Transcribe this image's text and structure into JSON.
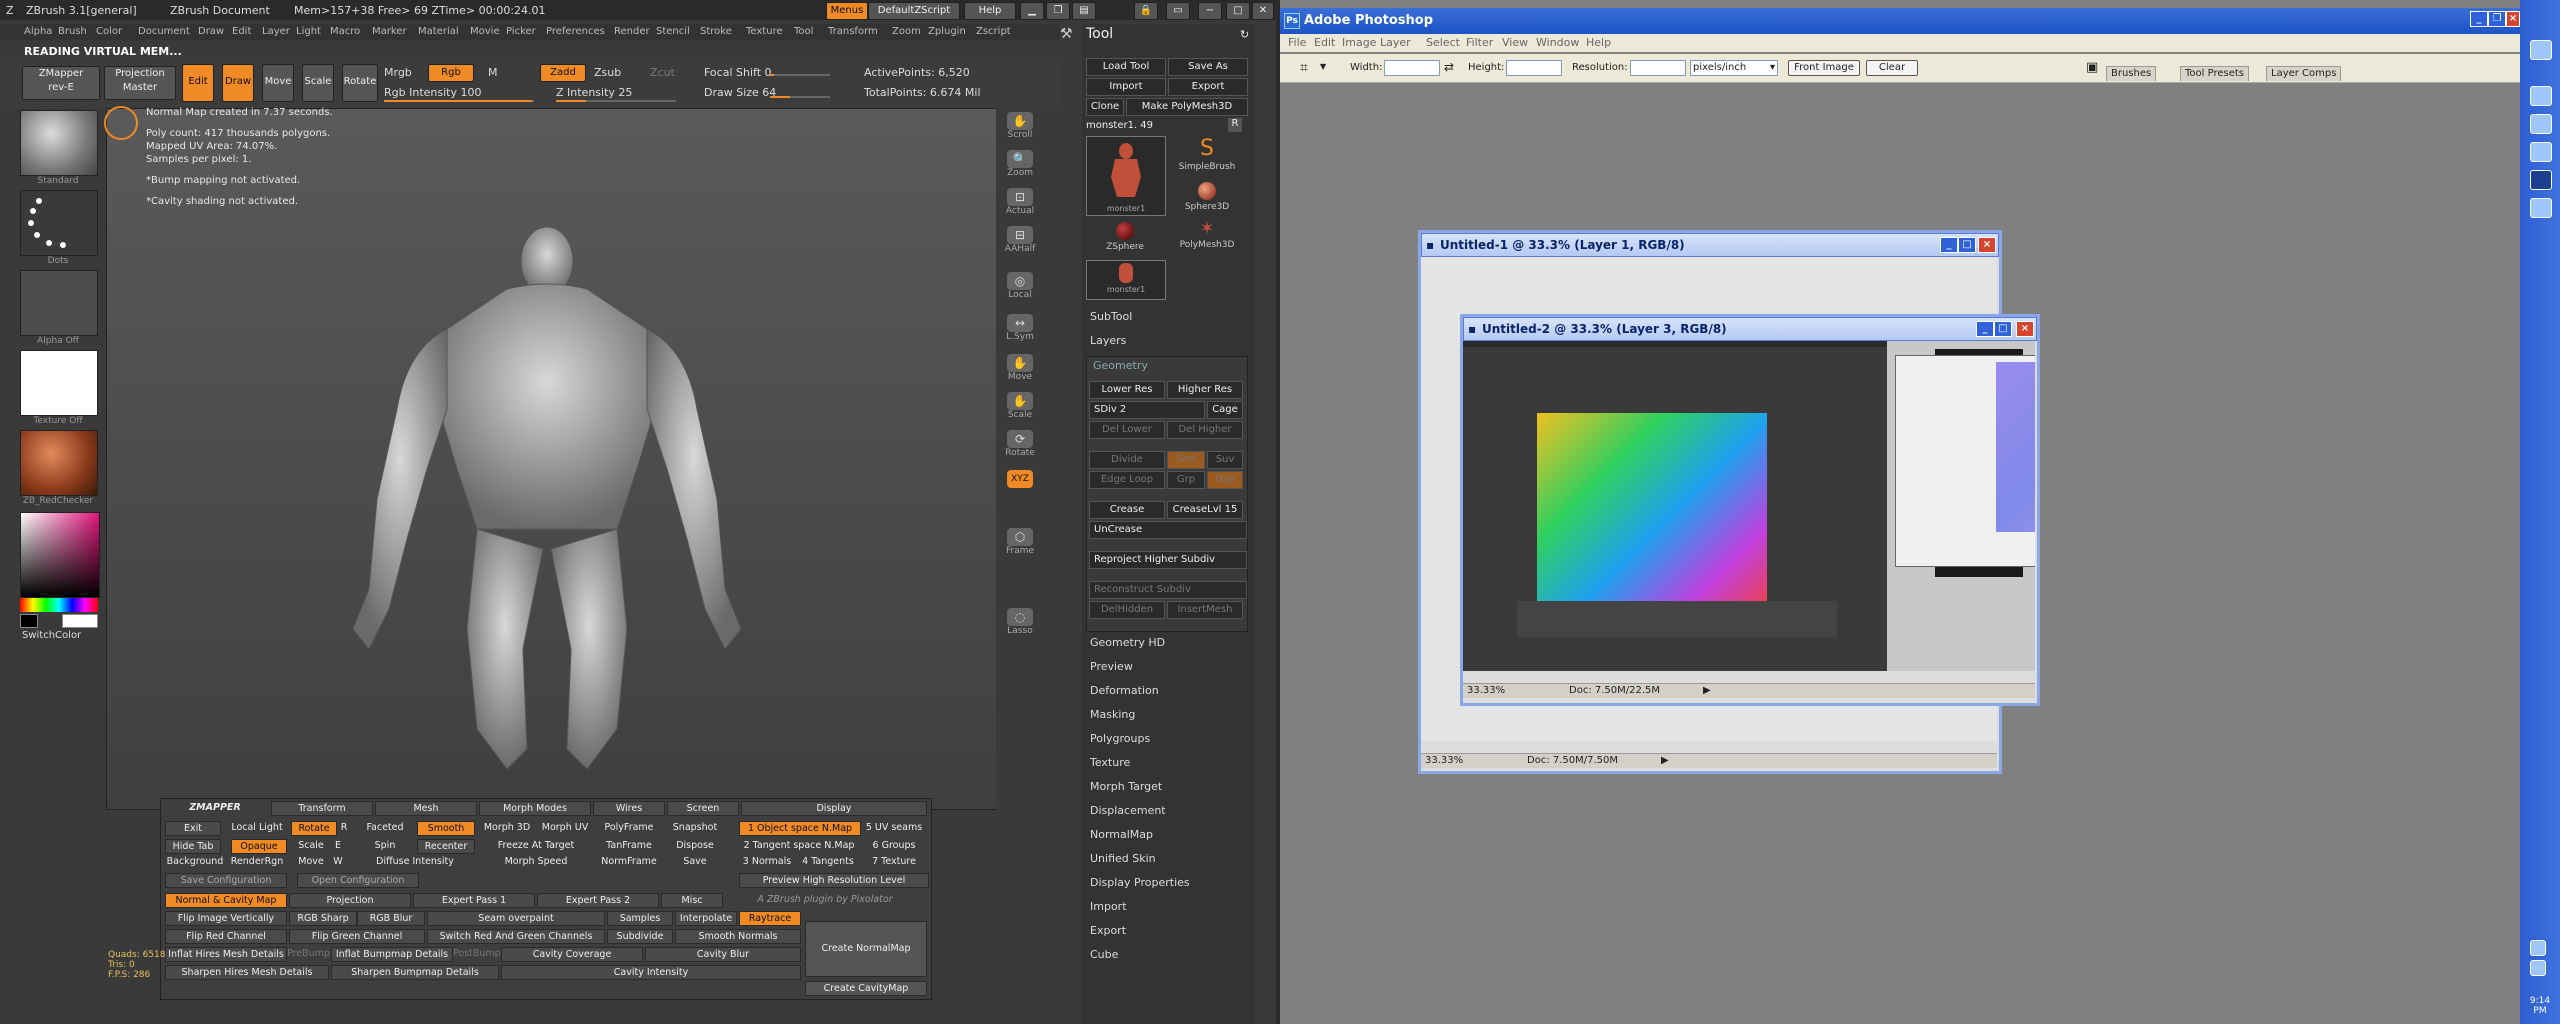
{
  "zbrush": {
    "title": "ZBrush 3.1[general]",
    "document": "ZBrush Document",
    "mem": "Mem>157+38  Free> 69  ZTime> 00:00:24.01",
    "menus_btn": "Menus",
    "script_btn": "DefaultZScript",
    "help_btn": "Help",
    "menubar": [
      "Alpha",
      "Brush",
      "Color",
      "Document",
      "Draw",
      "Edit",
      "Layer",
      "Light",
      "Macro",
      "Marker",
      "Material",
      "Movie",
      "Picker",
      "Preferences",
      "Render",
      "Stencil",
      "Stroke",
      "Texture",
      "Tool",
      "Transform",
      "Zoom",
      "Zplugin",
      "Zscript"
    ],
    "status_line": "READING VIRTUAL MEM...",
    "shelf": {
      "zmapper": "ZMapper",
      "zmapper_sub": "rev-E",
      "projection": "Projection",
      "projection_sub": "Master",
      "edit": "Edit",
      "draw": "Draw",
      "move": "Move",
      "scale": "Scale",
      "rotate": "Rotate",
      "mrgb": "Mrgb",
      "rgb": "Rgb",
      "m": "M",
      "zadd": "Zadd",
      "zsub": "Zsub",
      "zcut": "Zcut",
      "rgb_intensity": "Rgb Intensity 100",
      "z_intensity": "Z Intensity 25",
      "focal_shift": "Focal Shift 0",
      "draw_size": "Draw Size 64",
      "active_points": "ActivePoints: 6,520",
      "total_points": "TotalPoints: 6.674 Mil"
    },
    "left_labels": [
      "Standard",
      "Dots",
      "Alpha  Off",
      "Texture Off",
      "ZB_RedChecker",
      "SwitchColor"
    ],
    "info_lines": [
      "Normal Map created in 7.37 seconds.",
      "",
      "Poly count: 417 thousands polygons.",
      "Mapped UV Area: 74.07%.",
      "Samples per pixel: 1.",
      "",
      "*Bump mapping not activated.",
      "",
      "*Cavity shading not activated."
    ],
    "right_strip": [
      "Scroll",
      "Zoom",
      "Actual",
      "AAHalf",
      "Local",
      "L.Sym",
      "Move",
      "Scale",
      "Rotate",
      "XYZ",
      "Frame",
      "Lasso"
    ],
    "tool": {
      "header": "Tool",
      "load_tool": "Load Tool",
      "save_as": "Save As",
      "import": "Import",
      "export": "Export",
      "clone": "Clone",
      "make_polymesh": "Make PolyMesh3D",
      "current": "monster1. 49",
      "r": "R",
      "thumbs": [
        "monster1",
        "SimpleBrush",
        "Sphere3D",
        "ZSphere",
        "PolyMesh3D",
        "monster1"
      ],
      "subtool": "SubTool",
      "layers": "Layers",
      "geometry": "Geometry",
      "lower_res": "Lower Res",
      "higher_res": "Higher Res",
      "sdiv": "SDiv 2",
      "cage": "Cage",
      "del_lower": "Del Lower",
      "del_higher": "Del Higher",
      "divide": "Divide",
      "smt": "Smt",
      "suv": "Suv",
      "edge_loop": "Edge Loop",
      "grp": "Grp",
      "dsp": "Dsp",
      "crease": "Crease",
      "crease_lvl": "CreaseLvl 15",
      "uncrease": "UnCrease",
      "reproject": "Reproject Higher Subdiv",
      "reconstruct": "Reconstruct Subdiv",
      "delhidden": "DelHidden",
      "insertmesh": "InsertMesh",
      "sections": [
        "Geometry HD",
        "Preview",
        "Deformation",
        "Masking",
        "Polygroups",
        "Texture",
        "Morph Target",
        "Displacement",
        "NormalMap",
        "Unified Skin",
        "Display Properties",
        "Import",
        "Export",
        "Cube"
      ]
    },
    "zmapper": {
      "logo": "ZMAPPER",
      "tabs": [
        "Transform",
        "Mesh",
        "Morph Modes",
        "Wires",
        "Screen",
        "Display"
      ],
      "row1": [
        "Exit",
        "Local Light",
        "Rotate",
        "R",
        "Faceted",
        "Smooth",
        "Morph 3D",
        "Morph UV",
        "PolyFrame",
        "Snapshot",
        "1 Object space N.Map",
        "5 UV seams"
      ],
      "row2": [
        "Hide Tab",
        "Opaque",
        "Scale",
        "E",
        "Spin",
        "Recenter",
        "Freeze At Target",
        "TanFrame",
        "Dispose",
        "2 Tangent space N.Map",
        "6 Groups"
      ],
      "row3": [
        "Background",
        "RenderRgn",
        "Move",
        "W",
        "Diffuse Intensity",
        "Morph Speed",
        "NormFrame",
        "Save",
        "3 Normals",
        "4 Tangents",
        "7 Texture"
      ],
      "row4": [
        "Save Configuration",
        "Open Configuration",
        "Preview High Resolution Level"
      ],
      "subtabs": [
        "Normal & Cavity Map",
        "Projection",
        "Expert Pass 1",
        "Expert Pass 2",
        "Misc",
        "A ZBrush plugin by Pixolator"
      ],
      "row5": [
        "Flip Image Vertically",
        "RGB Sharp",
        "RGB Blur",
        "Seam overpaint",
        "Samples",
        "Interpolate",
        "Raytrace"
      ],
      "row6": [
        "Flip Red Channel",
        "Flip Green Channel",
        "Switch Red And Green Channels",
        "Subdivide",
        "Smooth Normals",
        "Create NormalMap"
      ],
      "row7": [
        "Inflat Hires Mesh Details",
        "PreBump",
        "Inflat Bumpmap Details",
        "PostBump",
        "Cavity Coverage",
        "Cavity Blur"
      ],
      "row8": [
        "Sharpen Hires Mesh Details",
        "Sharpen Bumpmap Details",
        "Cavity Intensity",
        "Create CavityMap"
      ]
    },
    "stats": [
      "Quads: 6518",
      "Tris: 0",
      "F.P.S: 286"
    ]
  },
  "photoshop": {
    "title": "Adobe Photoshop",
    "menubar": [
      "File",
      "Edit",
      "Image",
      "Layer",
      "Select",
      "Filter",
      "View",
      "Window",
      "Help"
    ],
    "width_label": "Width:",
    "height_label": "Height:",
    "resolution_label": "Resolution:",
    "units": "pixels/inch",
    "front_image": "Front Image",
    "clear": "Clear",
    "tabs": [
      "Brushes",
      "Tool Presets",
      "Layer Comps"
    ],
    "win1_title": "Untitled-1 @ 33.3% (Layer 1, RGB/8)",
    "win2_title": "Untitled-2 @ 33.3% (Layer 3, RGB/8)",
    "zoom1": "33.33%",
    "doc1": "Doc: 7.50M/7.50M",
    "zoom2": "33.33%",
    "doc2": "Doc: 7.50M/22.5M",
    "clock": "9:14 PM"
  },
  "colors": {
    "accent": "#f08a24",
    "zb_bg": "#3a3a3a",
    "ps_bg": "#808080",
    "xp_blue": "#1c52c4"
  }
}
